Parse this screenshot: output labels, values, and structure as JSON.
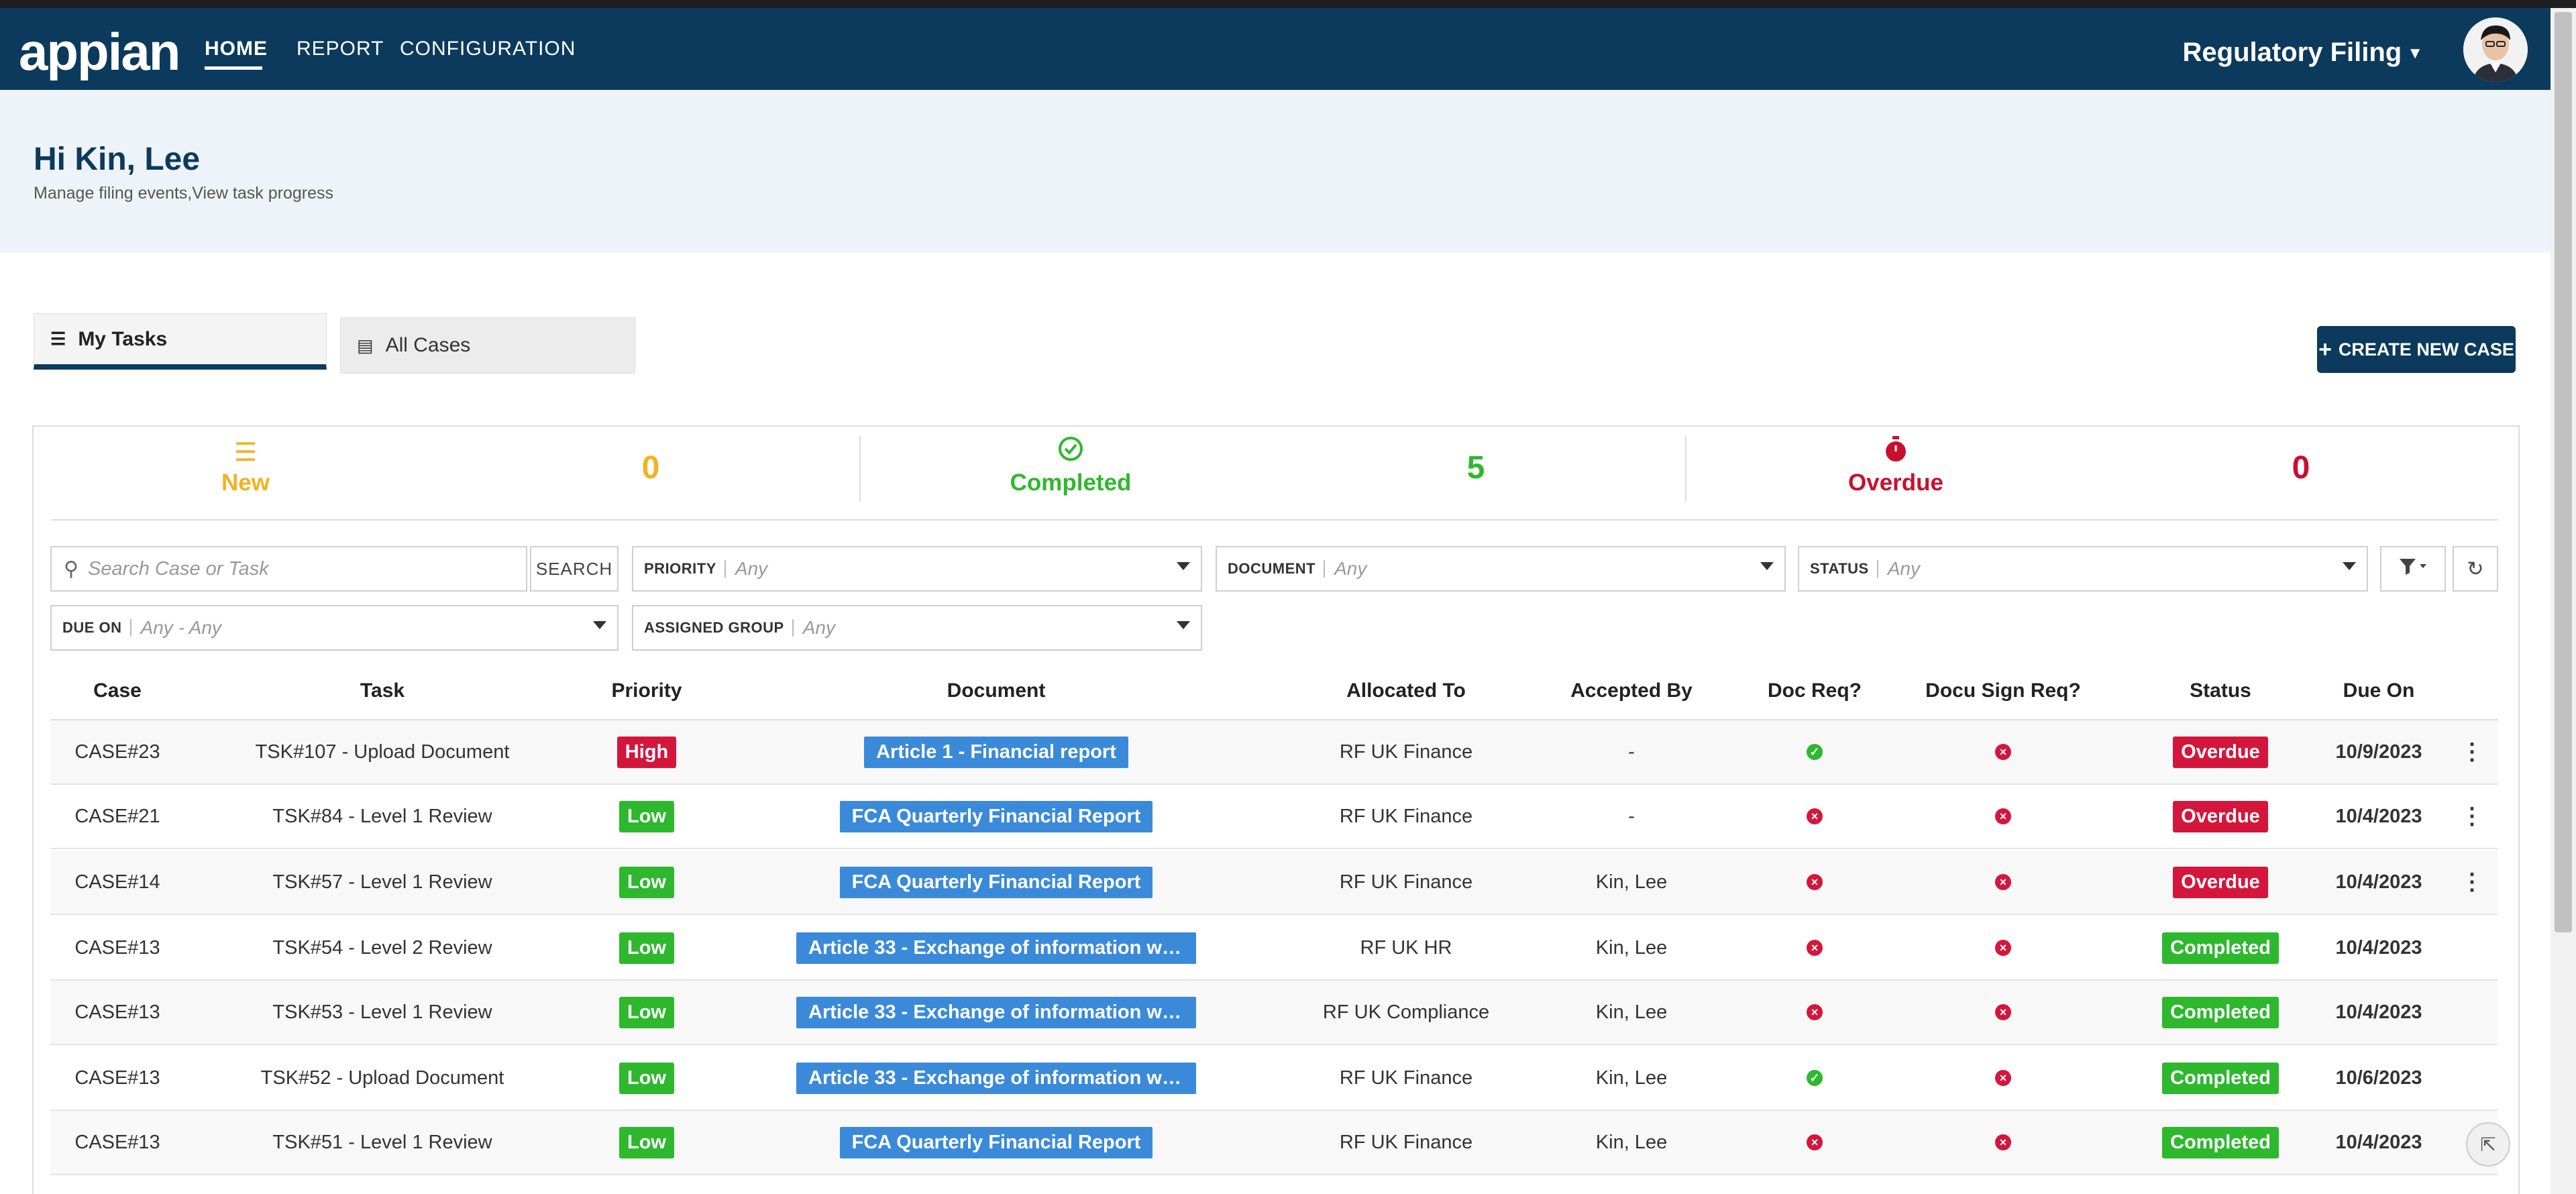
{
  "header": {
    "logo": "appian",
    "nav": [
      {
        "label": "HOME",
        "active": true
      },
      {
        "label": "REPORT",
        "active": false
      },
      {
        "label": "CONFIGURATION",
        "active": false
      }
    ],
    "app_switcher": "Regulatory Filing",
    "bg_color": "#0b3a5c"
  },
  "greeting": {
    "title": "Hi Kin, Lee",
    "subtitle": "Manage filing events,View task progress"
  },
  "tabs": [
    {
      "label": "My Tasks",
      "icon": "list-icon",
      "active": true
    },
    {
      "label": "All Cases",
      "icon": "document-icon",
      "active": false
    }
  ],
  "create_button": "CREATE NEW CASE",
  "stats": [
    {
      "label": "New",
      "value": "0",
      "icon": "list-icon",
      "color": "#f0b323"
    },
    {
      "label": "Completed",
      "value": "5",
      "icon": "check-circle-icon",
      "color": "#2eb82e"
    },
    {
      "label": "Overdue",
      "value": "0",
      "icon": "stopwatch-icon",
      "color": "#c8102e"
    }
  ],
  "filters": {
    "search_placeholder": "Search Case or Task",
    "search_button": "SEARCH",
    "priority": {
      "label": "PRIORITY",
      "value": "Any"
    },
    "document": {
      "label": "DOCUMENT",
      "value": "Any"
    },
    "status": {
      "label": "STATUS",
      "value": "Any"
    },
    "due_on": {
      "label": "DUE ON",
      "value": "Any - Any"
    },
    "assigned_group": {
      "label": "ASSIGNED GROUP",
      "value": "Any"
    }
  },
  "table": {
    "columns": [
      "Case",
      "Task",
      "Priority",
      "Document",
      "Allocated To",
      "Accepted By",
      "Doc Req?",
      "Docu Sign Req?",
      "Status",
      "Due On"
    ],
    "rows": [
      {
        "case": "CASE#23",
        "task": "TSK#107 - Upload Document",
        "priority": "High",
        "document": "Article 1 - Financial report",
        "allocated": "RF UK Finance",
        "accepted": "-",
        "doc_req": "yes",
        "sign_req": "no",
        "status": "Overdue",
        "due": "10/9/2023",
        "menu": true
      },
      {
        "case": "CASE#21",
        "task": "TSK#84 - Level 1 Review",
        "priority": "Low",
        "document": "FCA Quarterly Financial Report",
        "allocated": "RF UK Finance",
        "accepted": "-",
        "doc_req": "no",
        "sign_req": "no",
        "status": "Overdue",
        "due": "10/4/2023",
        "menu": true
      },
      {
        "case": "CASE#14",
        "task": "TSK#57 - Level 1 Review",
        "priority": "Low",
        "document": "FCA Quarterly Financial Report",
        "allocated": "RF UK Finance",
        "accepted": "Kin, Lee",
        "doc_req": "no",
        "sign_req": "no",
        "status": "Overdue",
        "due": "10/4/2023",
        "menu": true
      },
      {
        "case": "CASE#13",
        "task": "TSK#54 - Level 2 Review",
        "priority": "Low",
        "document": "Article 33 - Exchange of information wit...",
        "allocated": "RF UK HR",
        "accepted": "Kin, Lee",
        "doc_req": "no",
        "sign_req": "no",
        "status": "Completed",
        "due": "10/4/2023",
        "menu": false
      },
      {
        "case": "CASE#13",
        "task": "TSK#53 - Level 1 Review",
        "priority": "Low",
        "document": "Article 33 - Exchange of information wit...",
        "allocated": "RF UK Compliance",
        "accepted": "Kin, Lee",
        "doc_req": "no",
        "sign_req": "no",
        "status": "Completed",
        "due": "10/4/2023",
        "menu": false
      },
      {
        "case": "CASE#13",
        "task": "TSK#52 - Upload Document",
        "priority": "Low",
        "document": "Article 33 - Exchange of information wit...",
        "allocated": "RF UK Finance",
        "accepted": "Kin, Lee",
        "doc_req": "yes",
        "sign_req": "no",
        "status": "Completed",
        "due": "10/6/2023",
        "menu": false
      },
      {
        "case": "CASE#13",
        "task": "TSK#51 - Level 1 Review",
        "priority": "Low",
        "document": "FCA Quarterly Financial Report",
        "allocated": "RF UK Finance",
        "accepted": "Kin, Lee",
        "doc_req": "no",
        "sign_req": "no",
        "status": "Completed",
        "due": "10/4/2023",
        "menu": false
      }
    ]
  },
  "colors": {
    "high": "#d4163c",
    "low": "#2db82d",
    "overdue": "#d4163c",
    "completed": "#2db82d",
    "doc_badge": "#3b8ad9",
    "check": "#2db82d",
    "cross": "#d4163c"
  }
}
